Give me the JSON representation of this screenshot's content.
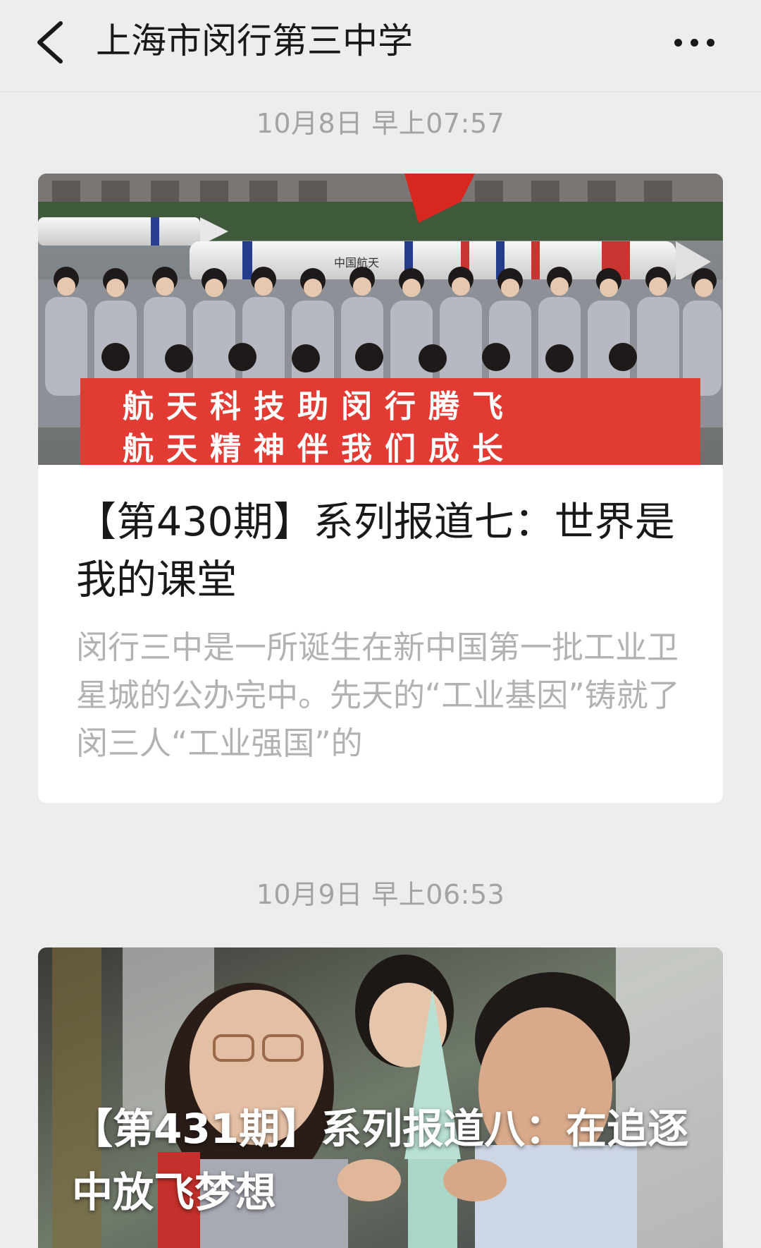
{
  "nav": {
    "title": "上海市闵行第三中学",
    "back_icon": "chevron-left-icon",
    "more_icon": "more-dots-icon"
  },
  "messages": [
    {
      "timestamp": "10月8日 早上07:57",
      "title": "【第430期】系列报道七：世界是我的课堂",
      "desc": "闵行三中是一所诞生在新中国第一批工业卫星城的公办完中。先天的“工业基因”铸就了闵三人“工业强国”的",
      "banner_line1": "航天科技助闵行腾飞",
      "banner_line2": "航天精神伴我们成长",
      "rocket_text": "中国航天"
    },
    {
      "timestamp": "10月9日 早上06:53",
      "title": "【第431期】系列报道八：在追逐中放飞梦想"
    }
  ],
  "colors": {
    "background": "#ededed",
    "card": "#ffffff",
    "title": "#191919",
    "desc": "#b2b2b2",
    "timestamp": "#a3a3a3",
    "banner_red": "#e23b33"
  }
}
